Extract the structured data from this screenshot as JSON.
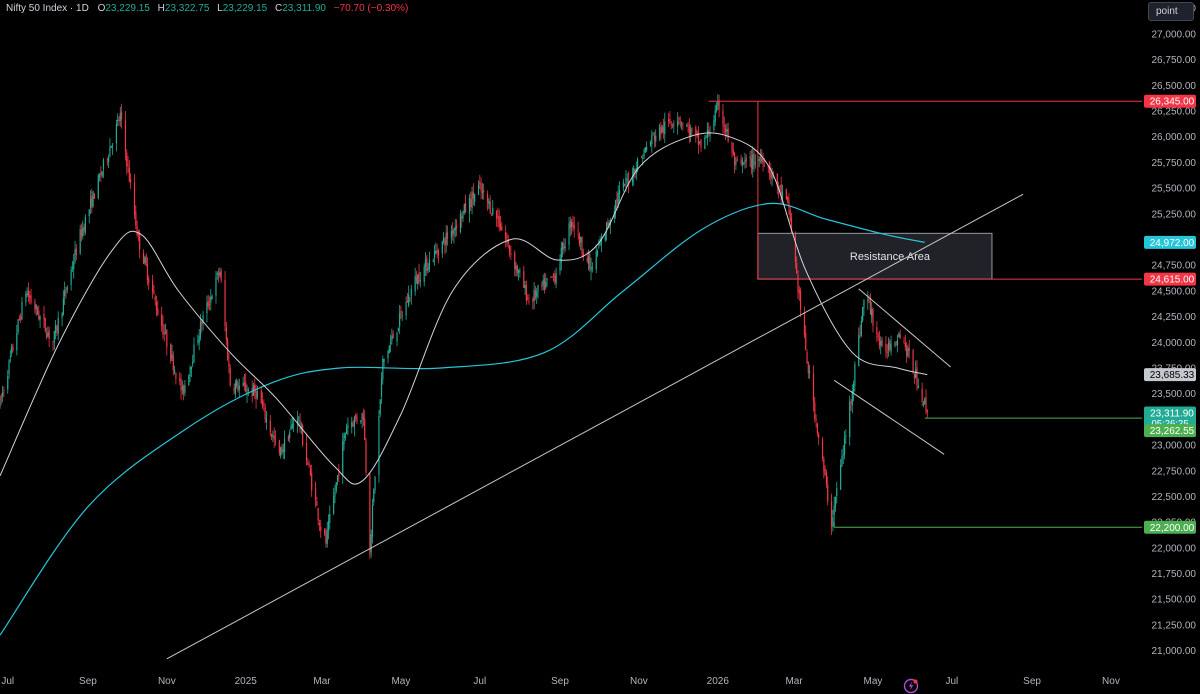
{
  "header": {
    "symbol": "Nifty 50 Index · 1D",
    "o_label": "O",
    "o_value": "23,229.15",
    "h_label": "H",
    "h_value": "23,322.75",
    "l_label": "L",
    "l_value": "23,229.15",
    "c_label": "C",
    "c_value": "23,311.90",
    "change": "−70.70 (−0.30%)"
  },
  "unit_button": "point",
  "colors": {
    "background": "#000000",
    "up": "#22ab94",
    "down": "#f23645",
    "ema_fast": "#d1d4dc",
    "ema_slow": "#26c6da",
    "trendline": "#c8c8c8",
    "support": "#4caf50",
    "resistance": "#f23645"
  },
  "chart_data": {
    "type": "candlestick",
    "y_ticks": [
      21000,
      21250,
      21500,
      21750,
      22000,
      22250,
      22500,
      22750,
      23000,
      23250,
      23500,
      23750,
      24000,
      24250,
      24500,
      24750,
      25000,
      25250,
      25500,
      25750,
      26000,
      26250,
      26500,
      26750,
      27000,
      27250
    ],
    "y_tick_labels": [
      "21,000.00",
      "21,250.00",
      "21,500.00",
      "21,750.00",
      "22,000.00",
      "22,250.00",
      "22,500.00",
      "22,750.00",
      "23,000.00",
      "23,250.00",
      "23,500.00",
      "23,750.00",
      "24,000.00",
      "24,250.00",
      "24,500.00",
      "24,750.00",
      "25,000.00",
      "25,250.00",
      "25,500.00",
      "25,750.00",
      "26,000.00",
      "26,250.00",
      "26,500.00",
      "26,750.00",
      "27,000.00",
      "27,250.00"
    ],
    "x_labels": [
      "Jul",
      "Sep",
      "Nov",
      "2025",
      "Mar",
      "May",
      "Jul",
      "Sep",
      "Nov",
      "2026",
      "Mar",
      "May",
      "Jul",
      "Sep",
      "Nov"
    ],
    "x_label_dates": [
      "2024-07-01",
      "2024-09-01",
      "2024-11-01",
      "2025-01-01",
      "2025-03-01",
      "2025-05-01",
      "2025-07-01",
      "2025-09-01",
      "2025-11-01",
      "2026-01-01",
      "2026-03-01",
      "2026-05-01",
      "2026-07-01",
      "2026-09-01",
      "2026-11-01"
    ],
    "x_range": [
      "2024-06-25",
      "2026-11-25"
    ],
    "y_range": [
      20870,
      27330
    ],
    "price_path": [
      [
        "2024-06-25",
        23400
      ],
      [
        "2024-07-15",
        24500
      ],
      [
        "2024-08-05",
        24000
      ],
      [
        "2024-08-25",
        25000
      ],
      [
        "2024-09-26",
        26200
      ],
      [
        "2024-10-10",
        25000
      ],
      [
        "2024-10-25",
        24300
      ],
      [
        "2024-11-13",
        23500
      ],
      [
        "2024-11-28",
        24200
      ],
      [
        "2024-12-12",
        24700
      ],
      [
        "2024-12-20",
        23600
      ],
      [
        "2025-01-10",
        23500
      ],
      [
        "2025-01-27",
        22900
      ],
      [
        "2025-02-10",
        23300
      ],
      [
        "2025-02-28",
        22200
      ],
      [
        "2025-03-04",
        22050
      ],
      [
        "2025-03-20",
        23200
      ],
      [
        "2025-04-02",
        23300
      ],
      [
        "2025-04-07",
        22000
      ],
      [
        "2025-04-17",
        23800
      ],
      [
        "2025-05-12",
        24600
      ],
      [
        "2025-06-10",
        25100
      ],
      [
        "2025-06-30",
        25500
      ],
      [
        "2025-07-15",
        25200
      ],
      [
        "2025-08-08",
        24400
      ],
      [
        "2025-08-28",
        24650
      ],
      [
        "2025-09-10",
        25200
      ],
      [
        "2025-09-25",
        24700
      ],
      [
        "2025-10-15",
        25400
      ],
      [
        "2025-11-12",
        26000
      ],
      [
        "2025-12-01",
        26200
      ],
      [
        "2025-12-20",
        25900
      ],
      [
        "2026-01-02",
        26300
      ],
      [
        "2026-01-15",
        25700
      ],
      [
        "2026-02-05",
        25800
      ],
      [
        "2026-02-25",
        25300
      ],
      [
        "2026-03-10",
        23900
      ],
      [
        "2026-03-30",
        22250
      ],
      [
        "2026-04-10",
        23100
      ],
      [
        "2026-04-25",
        24500
      ],
      [
        "2026-05-08",
        23900
      ],
      [
        "2026-05-22",
        24100
      ],
      [
        "2026-06-05",
        23600
      ],
      [
        "2026-06-12",
        23312
      ]
    ],
    "ema_fast_path": [
      [
        "2024-06-25",
        22700
      ],
      [
        "2024-08-10",
        24000
      ],
      [
        "2024-09-20",
        24900
      ],
      [
        "2024-10-12",
        25050
      ],
      [
        "2024-11-10",
        24500
      ],
      [
        "2024-12-20",
        23900
      ],
      [
        "2025-01-25",
        23450
      ],
      [
        "2025-03-10",
        22800
      ],
      [
        "2025-04-01",
        22650
      ],
      [
        "2025-05-01",
        23300
      ],
      [
        "2025-06-10",
        24500
      ],
      [
        "2025-07-25",
        25000
      ],
      [
        "2025-08-30",
        24800
      ],
      [
        "2025-09-30",
        24950
      ],
      [
        "2025-11-01",
        25700
      ],
      [
        "2025-12-10",
        26000
      ],
      [
        "2026-01-10",
        26000
      ],
      [
        "2026-02-10",
        25700
      ],
      [
        "2026-03-10",
        24700
      ],
      [
        "2026-04-15",
        23900
      ],
      [
        "2026-05-20",
        23750
      ],
      [
        "2026-06-12",
        23685
      ]
    ],
    "ema_slow_path": [
      [
        "2024-06-25",
        21150
      ],
      [
        "2024-09-01",
        22400
      ],
      [
        "2024-11-15",
        23150
      ],
      [
        "2025-01-20",
        23600
      ],
      [
        "2025-03-15",
        23750
      ],
      [
        "2025-06-01",
        23750
      ],
      [
        "2025-08-20",
        23900
      ],
      [
        "2025-10-20",
        24500
      ],
      [
        "2025-12-20",
        25100
      ],
      [
        "2026-02-10",
        25350
      ],
      [
        "2026-03-25",
        25200
      ],
      [
        "2026-05-10",
        25050
      ],
      [
        "2026-06-10",
        24972
      ]
    ],
    "trendlines": [
      {
        "from": [
          "2024-11-01",
          20920
        ],
        "to": [
          "2026-08-25",
          25440
        ]
      },
      {
        "from": [
          "2026-04-20",
          24520
        ],
        "to": [
          "2026-06-30",
          23760
        ]
      },
      {
        "from": [
          "2026-04-01",
          23630
        ],
        "to": [
          "2026-06-25",
          22910
        ]
      }
    ],
    "horizontal_lines": [
      {
        "value": 26345,
        "from": "2025-12-25",
        "color": "resistance"
      },
      {
        "value": 24615,
        "from": "2026-02-01",
        "color": "resistance"
      },
      {
        "value": 23262.55,
        "from": "2026-06-10",
        "color": "support"
      },
      {
        "value": 22200,
        "from": "2026-04-01",
        "color": "support"
      }
    ],
    "zone": {
      "label": "Resistance Area",
      "from": "2026-02-01",
      "to": "2026-08-01",
      "low": 24615,
      "high": 25060
    },
    "price_labels": [
      {
        "text": "26,345.00",
        "value": 26345,
        "color": "resistance"
      },
      {
        "text": "24,972.00",
        "value": 24972,
        "color": "ema_slow"
      },
      {
        "text": "24,615.00",
        "value": 24615,
        "color": "resistance"
      },
      {
        "text": "23,685.33",
        "value": 23685.33,
        "color": "ema_fast"
      },
      {
        "text": "23,311.90",
        "sub": "05:26:25",
        "value": 23311.9,
        "color": "up"
      },
      {
        "text": "23,262.55",
        "value": 23262.55,
        "color": "support"
      },
      {
        "text": "22,200.00",
        "value": 22200,
        "color": "support"
      }
    ]
  }
}
